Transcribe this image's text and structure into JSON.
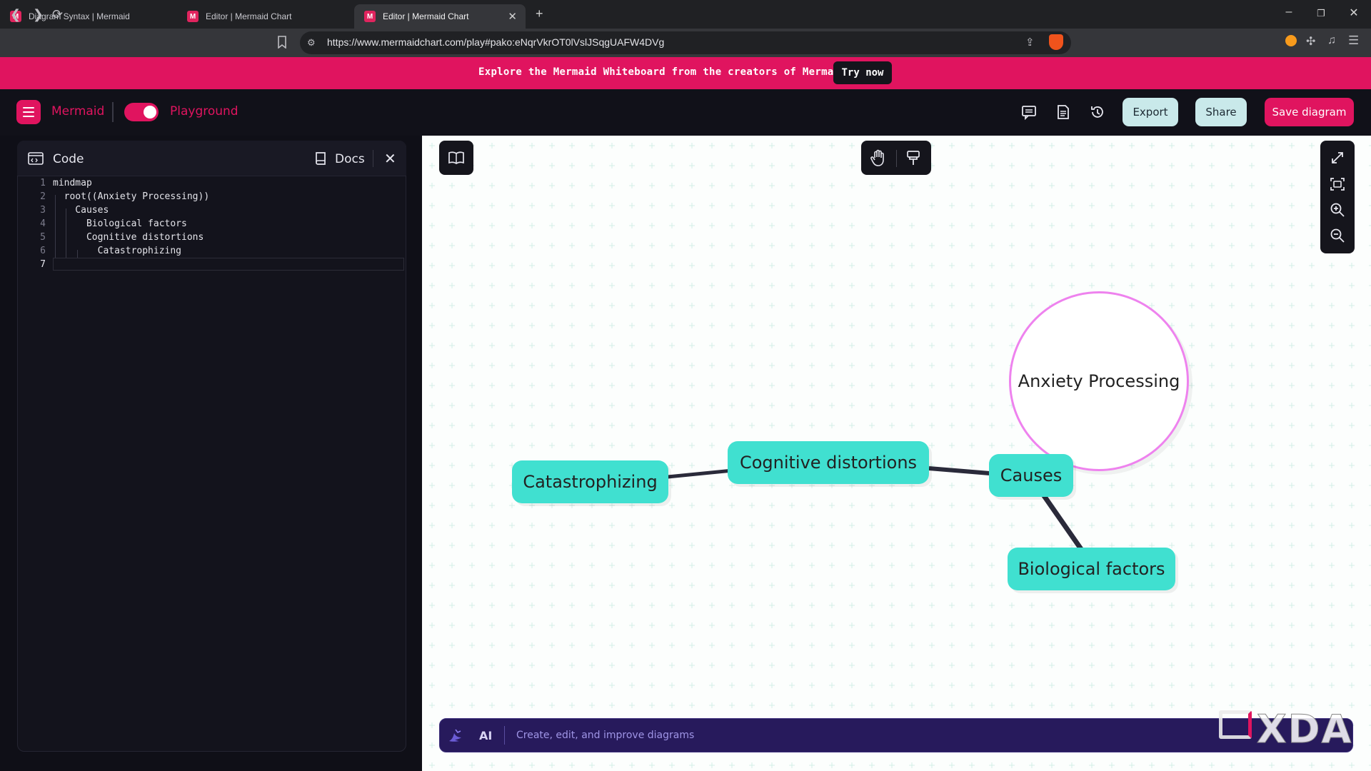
{
  "browser": {
    "tabs": [
      {
        "title": "Diagram Syntax | Mermaid"
      },
      {
        "title": "Editor | Mermaid Chart"
      },
      {
        "title": "Editor | Mermaid Chart"
      }
    ],
    "url": "https://www.mermaidchart.com/play#pako:eNqrVkrOT0lVslJSqgUAFW4DVg"
  },
  "banner": {
    "text": "Explore the Mermaid Whiteboard from the creators of Mermaid",
    "button": "Try now"
  },
  "header": {
    "brand": "Mermaid",
    "mode": "Playground",
    "export": "Export",
    "share": "Share",
    "save": "Save diagram"
  },
  "code_panel": {
    "title": "Code",
    "docs": "Docs",
    "lines": [
      {
        "num": "1",
        "text": "mindmap"
      },
      {
        "num": "2",
        "text": "  root((Anxiety Processing))"
      },
      {
        "num": "3",
        "text": "    Causes"
      },
      {
        "num": "4",
        "text": "      Biological factors"
      },
      {
        "num": "5",
        "text": "      Cognitive distortions"
      },
      {
        "num": "6",
        "text": "        Catastrophizing"
      },
      {
        "num": "7",
        "text": ""
      }
    ]
  },
  "diagram": {
    "root": "Anxiety Processing",
    "causes": "Causes",
    "biological": "Biological factors",
    "cognitive": "Cognitive distortions",
    "catastrophizing": "Catastrophizing",
    "node_color": "#40e0d0",
    "root_border_color": "#ee82ee"
  },
  "ai_bar": {
    "label": "AI",
    "placeholder": "Create, edit, and improve diagrams"
  },
  "watermark": "XDA",
  "colors": {
    "accent": "#e0145f",
    "pill": "#c9e9ea"
  }
}
